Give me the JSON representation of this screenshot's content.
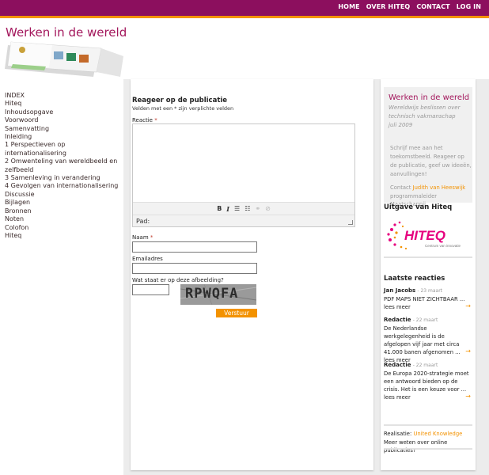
{
  "nav": {
    "home": "HOME",
    "about": "OVER HITEQ",
    "contact": "CONTACT",
    "login": "LOG IN"
  },
  "header": {
    "title": "Werken in de wereld"
  },
  "toc": [
    "INDEX",
    "Hiteq",
    "Inhoudsopgave",
    "Voorwoord",
    "Samenvatting",
    "Inleiding",
    "1 Perspectieven op internationalisering",
    "2 Omwenteling van wereldbeeld en",
    "zelfbeeld",
    "3 Samenleving in verandering",
    "4 Gevolgen van internationalisering",
    "Discussie",
    "Bijlagen",
    "Bronnen",
    "Noten",
    "Colofon",
    "Hiteq"
  ],
  "form": {
    "title": "Reageer op de publicatie",
    "note": "Velden met een * zijn verplichte velden",
    "reaction_label": "Reactie",
    "required_mark": "*",
    "path_label": "Pad:",
    "name_label": "Naam",
    "email_label": "Emailadres",
    "captcha_label": "Wat staat er op deze afbeelding?",
    "captcha_text": "RPWQFA",
    "submit": "Verstuur"
  },
  "sidebar": {
    "promo_title": "Werken in de wereld",
    "promo_subtitle": "Wereldwijs beslissen over technisch vakmanschap",
    "promo_date": "juli 2009",
    "promo_body": "Schrijf mee aan het toekomstbeeld. Reageer op de publicatie, geef uw ideeën, aanvullingen!",
    "contact_prefix": "Contact",
    "contact_name": "Judith van Heeswijk",
    "contact_role": "programmaleider Maatschappij",
    "publisher_heading": "Uitgave van Hiteq",
    "logo_text": "HITEQ",
    "logo_tagline": "Centrum van innovatie",
    "comments_heading": "Laatste reacties",
    "comments": [
      {
        "name": "Jan Jacobs",
        "date": "23 maart",
        "text": "PDF MAPS NIET ZICHTBAAR ...",
        "more": "lees meer"
      },
      {
        "name": "Redactie",
        "date": "22 maart",
        "text": "De Nederlandse werkgelegenheid is de afgelopen vijf jaar met circa 41.000 banen afgenomen ...",
        "more": "lees meer"
      },
      {
        "name": "Redactie",
        "date": "22 maart",
        "text": "De Europa 2020-strategie moet een antwoord bieden op de crisis. Het is een keuze voor ...",
        "more": "lees meer"
      }
    ],
    "arrow_glyph": "→",
    "realisation_prefix": "Realisatie:",
    "realisation_name": "United Knowledge",
    "more_info": "Meer weten over online publicaties?"
  },
  "colors": {
    "brand": "#8c0f5e",
    "accent": "#f39200",
    "title": "#a3175c"
  },
  "icons": {
    "bold": "bold-icon",
    "italic": "italic-icon",
    "unordered_list": "unordered-list-icon",
    "ordered_list": "ordered-list-icon",
    "link": "link-icon",
    "unlink": "unlink-icon"
  }
}
